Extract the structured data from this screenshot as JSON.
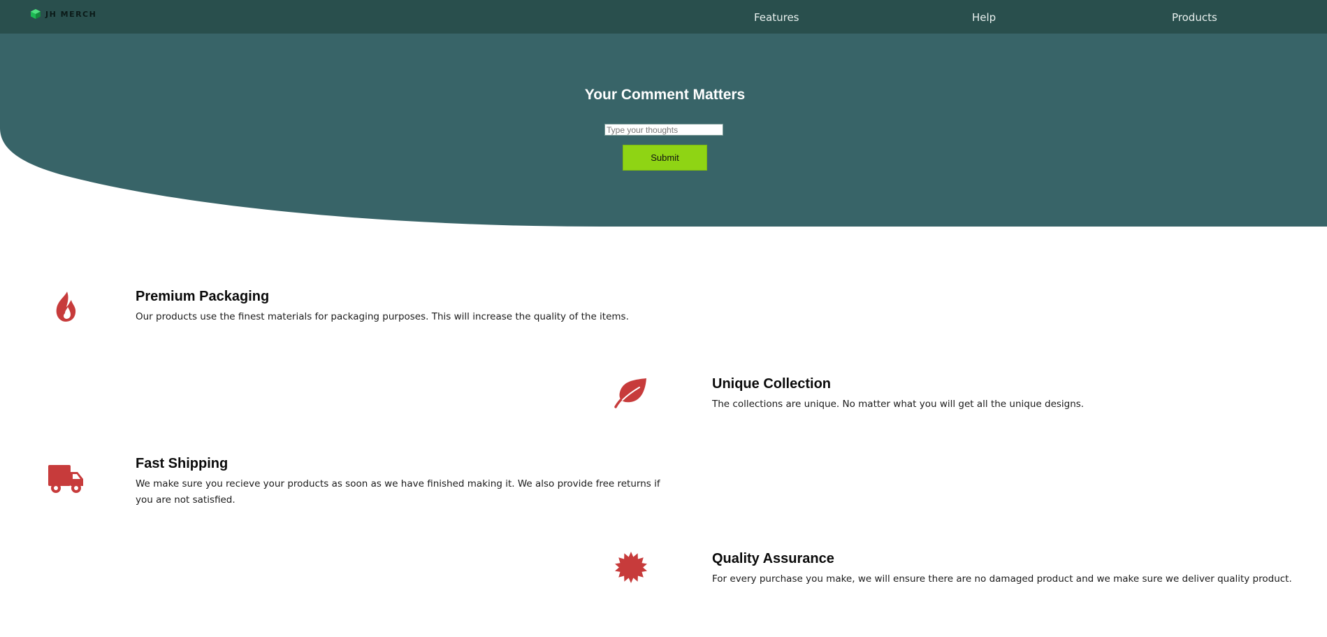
{
  "brand": {
    "name": "JH MERCH",
    "logo_icon": "green-cube-icon"
  },
  "nav": {
    "items": [
      {
        "label": "Features"
      },
      {
        "label": "Help"
      },
      {
        "label": "Products"
      }
    ]
  },
  "hero": {
    "title": "Your Comment Matters",
    "input_placeholder": "Type your thoughts",
    "input_value": "",
    "submit_label": "Submit"
  },
  "features": [
    {
      "icon": "fire-icon",
      "title": "Premium Packaging",
      "description": "Our products use the finest materials for packaging purposes. This will increase the quality of the items."
    },
    {
      "icon": "leaf-icon",
      "title": "Unique Collection",
      "description": "The collections are unique. No matter what you will get all the unique designs."
    },
    {
      "icon": "truck-icon",
      "title": "Fast Shipping",
      "description": "We make sure you recieve your products as soon as we have finished making it. We also provide free returns if you are not satisfied."
    },
    {
      "icon": "certificate-icon",
      "title": "Quality Assurance",
      "description": "For every purchase you make, we will ensure there are no damaged product and we make sure we deliver quality product."
    }
  ],
  "colors": {
    "navbar": "#294f4d",
    "hero": "#386468",
    "accent_button": "#8fd414",
    "icon_red": "#c73b3b",
    "logo_green": "#1db954"
  }
}
